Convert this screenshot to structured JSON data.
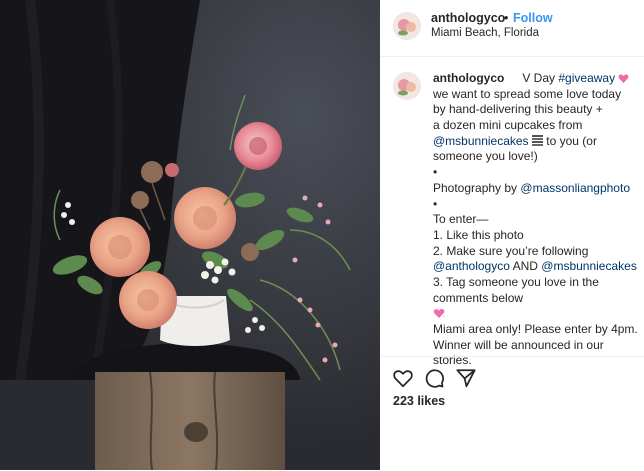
{
  "post": {
    "username": "anthologyco",
    "separator": "•",
    "follow_label": "Follow",
    "location": "Miami Beach, Florida",
    "avatar_icon": "floral-avatar-icon"
  },
  "caption": {
    "username": "anthologyco",
    "title_text": "V Day",
    "hashtag": "#giveaway",
    "heart_icon": "pink-heart-icon",
    "line2": "we want to spread some love today",
    "line3": "by hand-delivering this beauty +",
    "line4": "a dozen mini cupcakes from",
    "mention_bakery": "@msbunniecakes",
    "cupcake_icon": "cupcake-icon",
    "line5_rest": "to you (or",
    "line6": "someone you love!)",
    "bullet": "•",
    "photo_credit_prefix": "Photography by",
    "mention_photographer": "@massonliangphoto",
    "to_enter": "To enter—",
    "step1": "1. Like this photo",
    "step2": "2. Make sure you’re following",
    "mention_account": "@anthologyco",
    "and_word": "AND",
    "mention_bakery_2": "@msbunniecakes",
    "step3_a": "3. Tag someone you love in the",
    "step3_b": "comments below",
    "sparkle_heart_icon": "sparkling-heart-icon",
    "footer1": "Miami area only! Please enter by 4pm.",
    "footer2": "Winner will be announced in our",
    "footer3": "stories."
  },
  "actions": {
    "like_icon": "heart-outline-icon",
    "comment_icon": "comment-bubble-icon",
    "share_icon": "paper-plane-icon",
    "likes_text": "223 likes"
  },
  "colors": {
    "link_blue": "#3897f0",
    "mention_blue": "#003569",
    "text": "#262626",
    "border": "#efefef",
    "heart_pink": "#f06ca8"
  }
}
